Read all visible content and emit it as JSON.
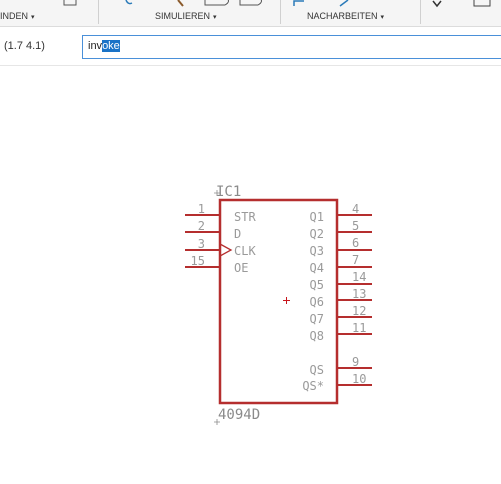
{
  "toolbar": {
    "groups": [
      {
        "label": "INDEN",
        "caret": "▾"
      },
      {
        "label": "SIMULIEREN",
        "caret": "▾"
      },
      {
        "label": "NACHARBEITEN",
        "caret": "▾"
      }
    ]
  },
  "commandbar": {
    "coordinates": "(1.7 4.1)",
    "input_value_before": "inv",
    "input_value_selected": "oke",
    "input_value": "invoke"
  },
  "schematic": {
    "part_name": "IC1",
    "part_value": "4094D",
    "colors": {
      "body": "#b52e2e",
      "pin_text": "#9a9a9a",
      "label_text": "#8a8a8a",
      "origin": "#c8161d"
    },
    "left_pins": [
      {
        "number": "1",
        "name": "STR"
      },
      {
        "number": "2",
        "name": "D"
      },
      {
        "number": "3",
        "name": "CLK"
      },
      {
        "number": "15",
        "name": "OE"
      }
    ],
    "right_pins": [
      {
        "number": "4",
        "name": "Q1"
      },
      {
        "number": "5",
        "name": "Q2"
      },
      {
        "number": "6",
        "name": "Q3"
      },
      {
        "number": "7",
        "name": "Q4"
      },
      {
        "number": "14",
        "name": "Q5"
      },
      {
        "number": "13",
        "name": "Q6"
      },
      {
        "number": "12",
        "name": "Q7"
      },
      {
        "number": "11",
        "name": "Q8"
      },
      {
        "number": "9",
        "name": "QS"
      },
      {
        "number": "10",
        "name": "QS*"
      }
    ]
  }
}
